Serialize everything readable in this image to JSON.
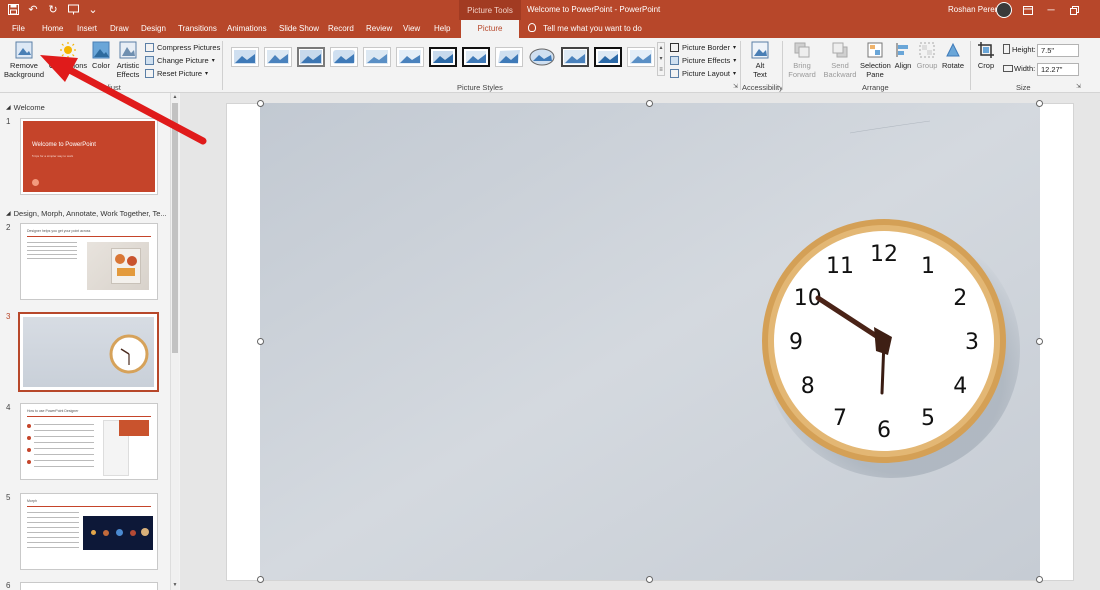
{
  "window": {
    "doc_title": "Welcome to PowerPoint  -  PowerPoint",
    "context_group": "Picture Tools",
    "user_name": "Roshan Perera",
    "tell_me": "Tell me what you want to do"
  },
  "tabs": [
    {
      "label": "File"
    },
    {
      "label": "Home"
    },
    {
      "label": "Insert"
    },
    {
      "label": "Draw"
    },
    {
      "label": "Design"
    },
    {
      "label": "Transitions"
    },
    {
      "label": "Animations"
    },
    {
      "label": "Slide Show"
    },
    {
      "label": "Record"
    },
    {
      "label": "Review"
    },
    {
      "label": "View"
    },
    {
      "label": "Help"
    },
    {
      "label": "Picture Format"
    }
  ],
  "ribbon": {
    "remove_bg_line1": "Remove",
    "remove_bg_line2": "Background",
    "corrections": "Corrections",
    "color": "Color",
    "artistic_line1": "Artistic",
    "artistic_line2": "Effects",
    "compress": "Compress Pictures",
    "change": "Change Picture",
    "reset": "Reset Picture",
    "adjust_label": "Adjust",
    "picture_styles_label": "Picture Styles",
    "border": "Picture Border",
    "effects": "Picture Effects",
    "layout": "Picture Layout",
    "alt_line1": "Alt",
    "alt_line2": "Text",
    "accessibility_label": "Accessibility",
    "bring_line1": "Bring",
    "bring_line2": "Forward",
    "send_line1": "Send",
    "send_line2": "Backward",
    "selection_line1": "Selection",
    "selection_line2": "Pane",
    "align": "Align",
    "group": "Group",
    "rotate": "Rotate",
    "arrange_label": "Arrange",
    "crop": "Crop",
    "height_label": "Height:",
    "height_value": "7.5\"",
    "width_label": "Width:",
    "width_value": "12.27\"",
    "size_label": "Size"
  },
  "slides_panel": {
    "section1": "Welcome",
    "section2": "Design, Morph, Annotate, Work Together, Te...",
    "slides": [
      {
        "num": "1",
        "title": "Welcome to PowerPoint",
        "subtitle": "5 tips for a simpler way to work"
      },
      {
        "num": "2",
        "title": "Designer helps you get your point across"
      },
      {
        "num": "3"
      },
      {
        "num": "4",
        "title": "How to use PowerPoint Designer"
      },
      {
        "num": "5",
        "title": "Morph"
      },
      {
        "num": "6"
      }
    ]
  },
  "clock": {
    "numbers": [
      "12",
      "1",
      "2",
      "3",
      "4",
      "5",
      "6",
      "7",
      "8",
      "9",
      "10",
      "11"
    ]
  },
  "colors": {
    "accent": "#b7472a",
    "ribbon_bg": "#f3f3f3",
    "clock_rim": "#d6a25a",
    "arrow": "#e01b1b"
  }
}
